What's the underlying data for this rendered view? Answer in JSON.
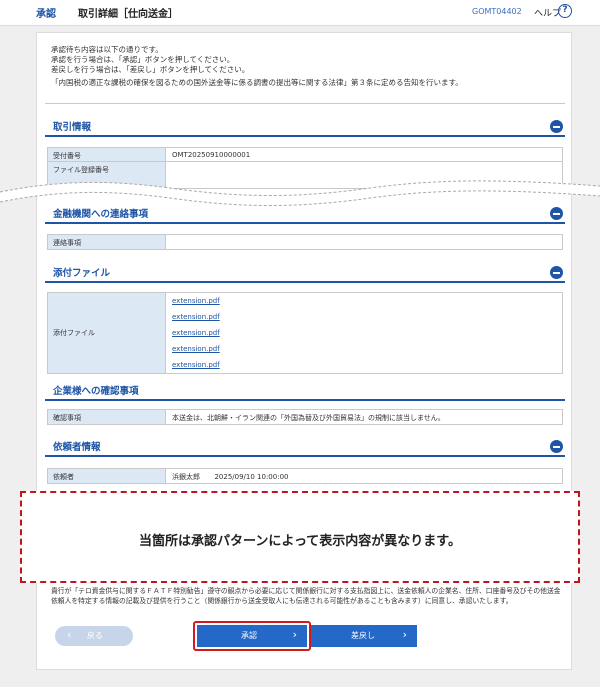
{
  "header": {
    "section": "承認",
    "title": "取引詳細［仕向送金］",
    "screen_code": "GOMT04402",
    "help_label": "ヘルプ",
    "help_icon": "?"
  },
  "intro": {
    "line1": "承認待ち内容は以下の通りです。",
    "line2": "承認を行う場合は、「承認」ボタンを押してください。",
    "line3": "差戻しを行う場合は、「差戻し」ボタンを押してください。",
    "line4": "「内国税の適正な課税の確保を図るための国外送金等に係る調書の提出等に関する法律」第３条に定める告知を行います。"
  },
  "transaction": {
    "title": "取引情報",
    "rows": [
      {
        "label": "受付番号",
        "value": "OMT20250910000001"
      },
      {
        "label": "ファイル登録番号",
        "value": ""
      }
    ]
  },
  "bank_contact": {
    "title": "金融機関への連絡事項",
    "label": "連絡事項",
    "value": ""
  },
  "attachments": {
    "title": "添付ファイル",
    "label": "添付ファイル",
    "files": [
      "extension.pdf",
      "extension.pdf",
      "extension.pdf",
      "extension.pdf",
      "extension.pdf"
    ]
  },
  "confirmation": {
    "title": "企業様への確認事項",
    "label": "確認事項",
    "value": "本送金は、北朝鮮・イラン関連の「外国為替及び外国貿易法」の規制に該当しません。"
  },
  "requester": {
    "title": "依頼者情報",
    "label": "依頼者",
    "name": "浜銀太郎",
    "datetime": "2025/09/10 10:00:00"
  },
  "overlay_message": "当箇所は承認パターンによって表示内容が異なります。",
  "notice": "貴行が「テロ資金供与に関するＦＡＴＦ特別勧告」遵守の観点から必要に応じて関係銀行に対する支払指図上に、送金依頼人の企業名、住所、口座番号及びその他送金依頼人を特定する情報の記載及び提供を行うこと（関係銀行から送金受取人にも伝達される可能性があることも含みます）に同意し、承認いたします。",
  "buttons": {
    "back": "戻る",
    "approve": "承認",
    "return": "差戻し"
  },
  "colors": {
    "accent": "#1e55a6",
    "button": "#2468c8",
    "highlight": "#d21a21",
    "table_header": "#dde8f5"
  }
}
